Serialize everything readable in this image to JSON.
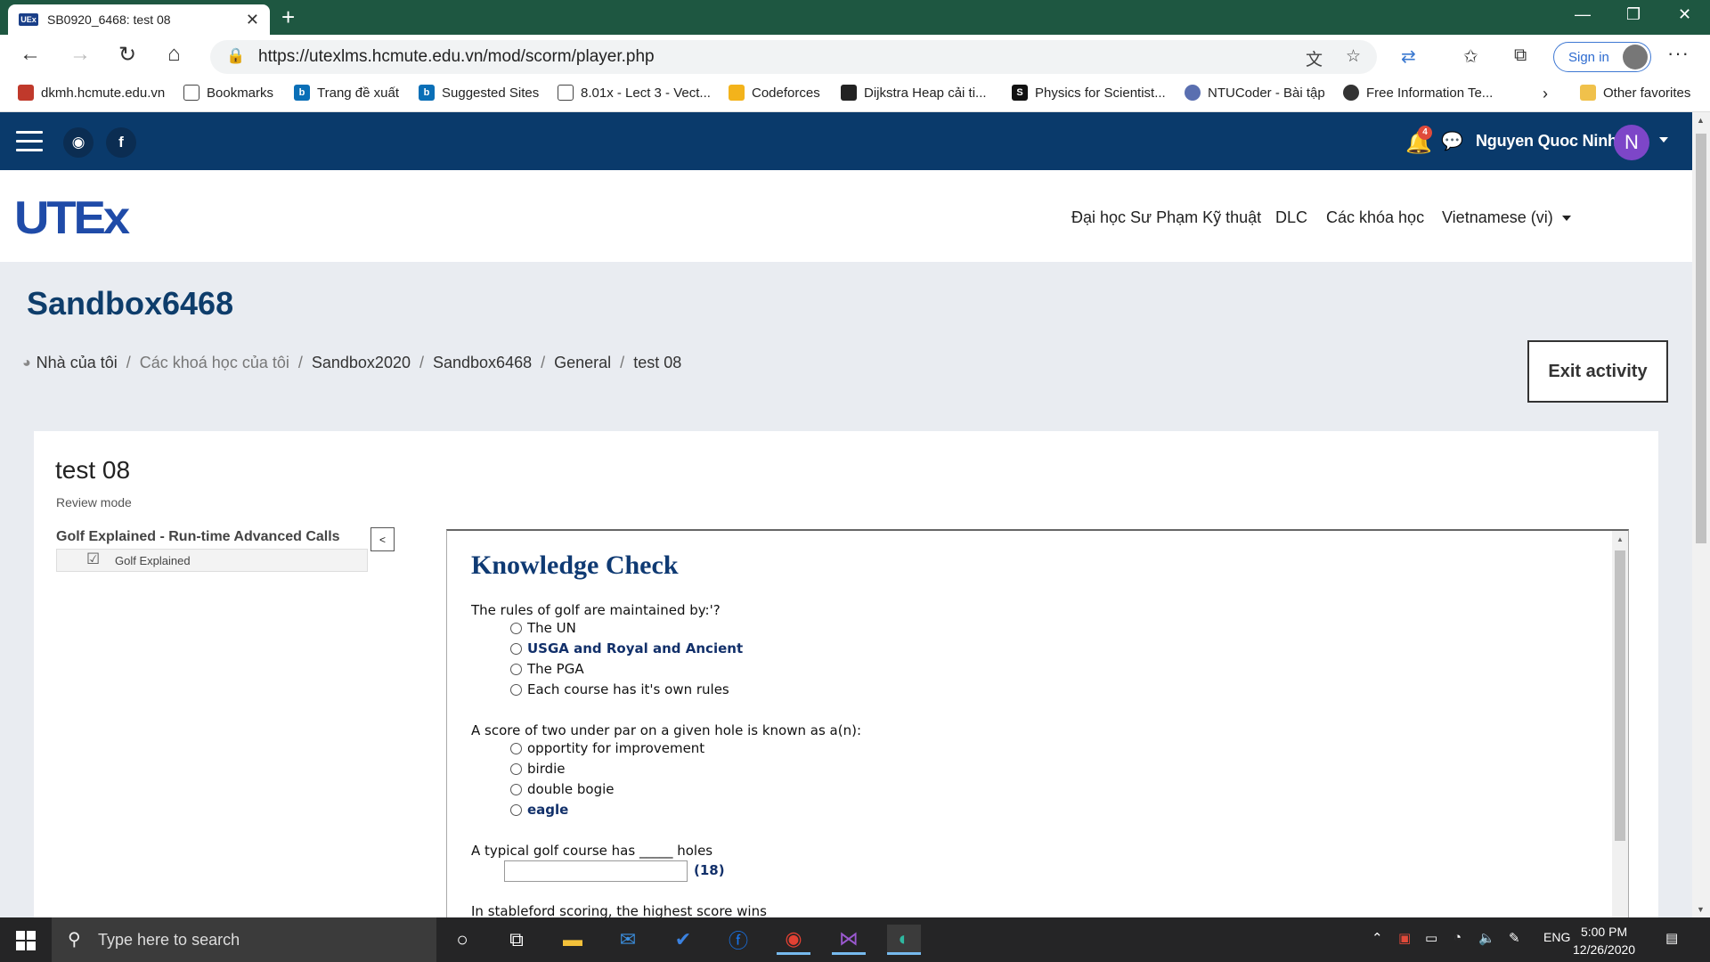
{
  "browser": {
    "tab_title": "SB0920_6468: test 08",
    "tab_favicon": "UEx",
    "url": "https://utexlms.hcmute.edu.vn/mod/scorm/player.php",
    "signin_label": "Sign in",
    "bookmarks": [
      {
        "label": "dkmh.hcmute.edu.vn",
        "icon": "hcmute-icon",
        "color": "#c0392b"
      },
      {
        "label": "Bookmarks",
        "icon": "page-icon",
        "color": "#ffffff"
      },
      {
        "label": "Trang đề xuất",
        "icon": "bing-icon",
        "color": "#0a6fb7"
      },
      {
        "label": "Suggested Sites",
        "icon": "bing-icon",
        "color": "#0a6fb7"
      },
      {
        "label": "8.01x - Lect 3 - Vect...",
        "icon": "page-icon",
        "color": "#ffffff"
      },
      {
        "label": "Codeforces",
        "icon": "codeforces-icon",
        "color": "#f3b31b"
      },
      {
        "label": "Dijkstra Heap cải ti...",
        "icon": "site-icon",
        "color": "#222222"
      },
      {
        "label": "Physics for Scientist...",
        "icon": "s-icon",
        "color": "#111111"
      },
      {
        "label": "NTUCoder - Bài tập",
        "icon": "ntu-icon",
        "color": "#5a6fb0"
      },
      {
        "label": "Free Information Te...",
        "icon": "info-icon",
        "color": "#333333"
      }
    ],
    "other_favorites": "Other favorites"
  },
  "topbar": {
    "notification_count": "4",
    "user_name": "Nguyen Quoc Ninh",
    "user_initial": "N"
  },
  "nav": {
    "logo": "UTEx",
    "menu": [
      "Đại học Sư Phạm Kỹ thuật",
      "DLC",
      "Các khóa học",
      "Vietnamese (vi)"
    ]
  },
  "course": {
    "title": "Sandbox6468",
    "breadcrumb": [
      "Nhà của tôi",
      "Các khoá học của tôi",
      "Sandbox2020",
      "Sandbox6468",
      "General",
      "test 08"
    ],
    "exit_label": "Exit activity"
  },
  "activity": {
    "title": "test 08",
    "mode": "Review mode",
    "toc_title": "Golf Explained - Run-time Advanced Calls",
    "toc_item": "Golf Explained",
    "toc_toggle": "<"
  },
  "quiz": {
    "heading": "Knowledge Check",
    "q1": {
      "text": "The rules of golf are maintained by:'?",
      "options": [
        "The UN",
        "USGA and Royal and Ancient",
        "The PGA",
        "Each course has it's own rules"
      ]
    },
    "q2": {
      "text": "A score of two under par on a given hole is known as a(n):",
      "options": [
        "opportity for improvement",
        "birdie",
        "double bogie",
        "eagle"
      ]
    },
    "q3": {
      "text": "A typical golf course has _____ holes",
      "answer": "(18)"
    },
    "q4": {
      "text": "In stableford scoring, the highest score wins"
    }
  },
  "taskbar": {
    "search_placeholder": "Type here to search",
    "lang": "ENG",
    "time": "5:00 PM",
    "date": "12/26/2020"
  }
}
